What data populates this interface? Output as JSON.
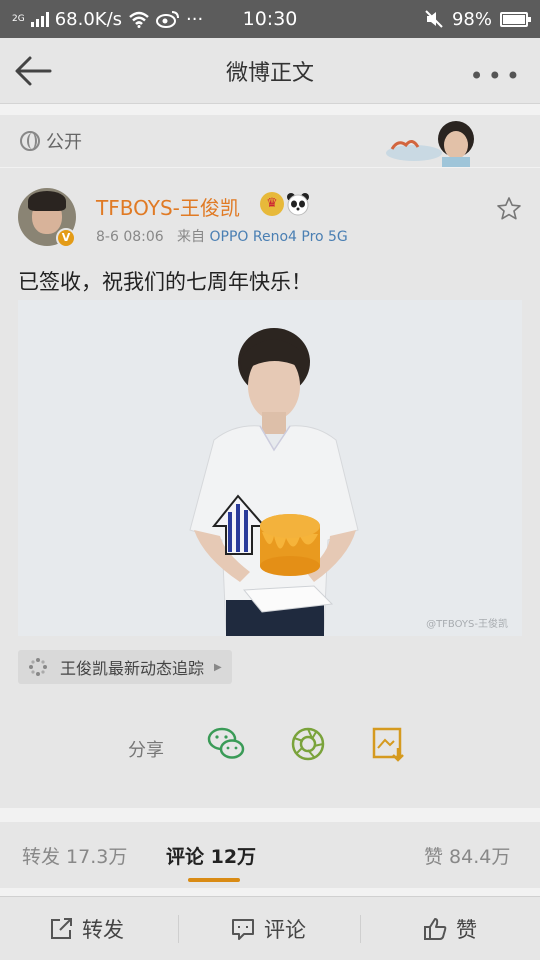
{
  "status_bar": {
    "network_type": "2G",
    "speed": "68.0K/s",
    "more": "···",
    "time": "10:30",
    "battery": "98%",
    "battery_level": 0.98
  },
  "header": {
    "title": "微博正文",
    "more": "•••"
  },
  "visibility": {
    "label": "公开"
  },
  "post": {
    "username": "TFBOYS-王俊凯",
    "verified_badge": "V",
    "crown_badge": "♛",
    "timestamp": "8-6 08:06",
    "source_prefix": "来自",
    "source_device": "OPPO Reno4 Pro 5G",
    "text": "已签收，祝我们的七周年快乐！",
    "photo_watermark": "@TFBOYS-王俊凯",
    "topic_tag": "王俊凯最新动态追踪",
    "tag_arrow": "▶"
  },
  "share": {
    "label": "分享"
  },
  "tabs": {
    "repost": "转发 17.3万",
    "comment": "评论 12万",
    "like": "赞 84.4万"
  },
  "bottom_bar": {
    "repost": "转发",
    "comment": "评论",
    "like": "赞"
  },
  "colors": {
    "accent": "#d98b14",
    "username": "#e07a24",
    "link": "#4a7fb3"
  }
}
